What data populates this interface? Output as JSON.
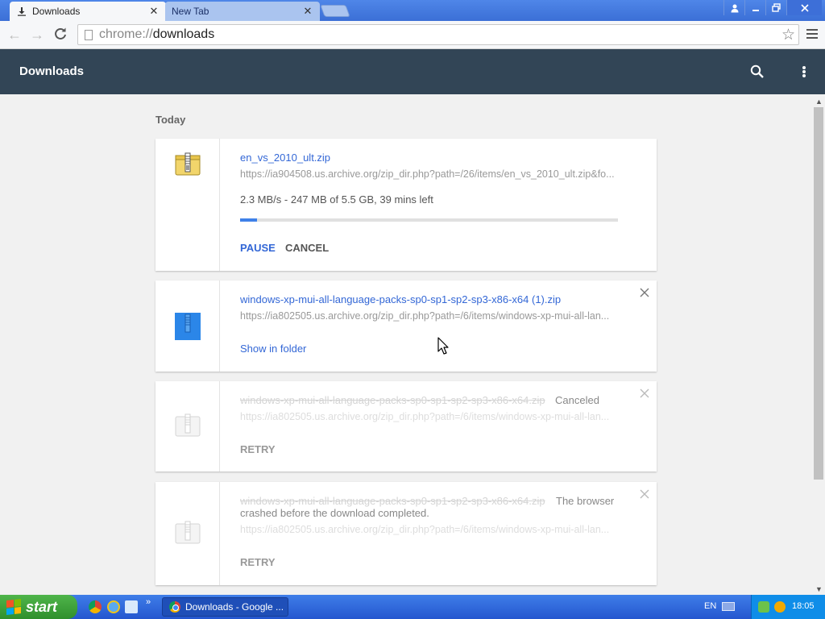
{
  "browser": {
    "tabs": [
      {
        "label": "Downloads",
        "icon": "download-icon",
        "active": true
      },
      {
        "label": "New Tab",
        "icon": null,
        "active": false
      }
    ],
    "window_buttons": [
      "user-icon",
      "minimize-icon",
      "restore-icon",
      "close-icon"
    ],
    "address": {
      "scheme": "chrome://",
      "host": "downloads"
    }
  },
  "page": {
    "title": "Downloads",
    "header_icons": [
      "search-icon",
      "more-vert-icon"
    ],
    "date_group": "Today"
  },
  "downloads": [
    {
      "name": "en_vs_2010_ult.zip",
      "url": "https://ia904508.us.archive.org/zip_dir.php?path=/26/items/en_vs_2010_ult.zip&fo...",
      "status": "2.3 MB/s - 247 MB of 5.5 GB, 39 mins left",
      "progress_fraction": 0.044,
      "actions": [
        "PAUSE",
        "CANCEL"
      ],
      "icon": "zip-file-icon-yellow"
    },
    {
      "name": "windows-xp-mui-all-language-packs-sp0-sp1-sp2-sp3-x86-x64 (1).zip",
      "url": "https://ia802505.us.archive.org/zip_dir.php?path=/6/items/windows-xp-mui-all-lan...",
      "link": "Show in folder",
      "icon": "zip-file-icon-blue"
    },
    {
      "name": "windows-xp-mui-all-language-packs-sp0-sp1-sp2-sp3-x86-x64.zip",
      "url": "https://ia802505.us.archive.org/zip_dir.php?path=/6/items/windows-xp-mui-all-lan...",
      "note": "Canceled",
      "action": "RETRY",
      "icon": "zip-file-icon-faded"
    },
    {
      "name": "windows-xp-mui-all-language-packs-sp0-sp1-sp2-sp3-x86-x64.zip",
      "url": "https://ia802505.us.archive.org/zip_dir.php?path=/6/items/windows-xp-mui-all-lan...",
      "note_line1": "The browser",
      "note_line2": "crashed before the download completed.",
      "action": "RETRY",
      "icon": "zip-file-icon-faded"
    }
  ],
  "taskbar": {
    "start_label": "start",
    "task_label": "Downloads - Google ...",
    "language": "EN",
    "clock": "18:05"
  },
  "colors": {
    "header_bg": "#324556",
    "link_blue": "#3367d6",
    "progress_blue": "#3f81e8",
    "titlebar_blue": "#3b6fd6",
    "taskbar_blue": "#2456cf",
    "start_green": "#2f8f2d"
  }
}
